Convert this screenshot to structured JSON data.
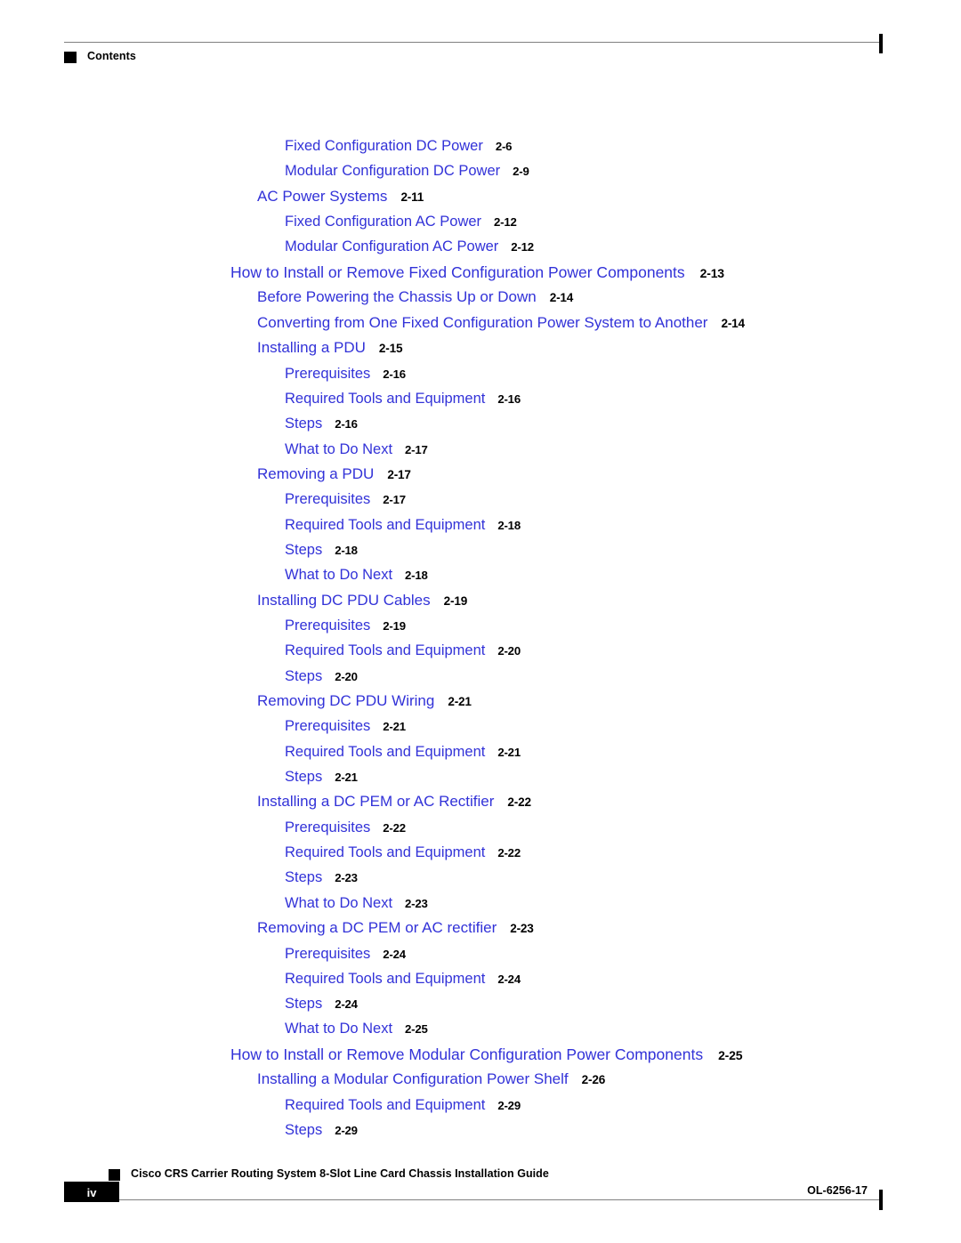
{
  "header": {
    "label": "Contents",
    "marker_icon": "black-square-icon"
  },
  "toc": {
    "entries": [
      {
        "level": 3,
        "title": "Fixed Configuration DC Power",
        "page": "2-6"
      },
      {
        "level": 3,
        "title": "Modular Configuration DC Power",
        "page": "2-9"
      },
      {
        "level": 2,
        "title": "AC Power Systems",
        "page": "2-11"
      },
      {
        "level": 3,
        "title": "Fixed Configuration AC Power",
        "page": "2-12"
      },
      {
        "level": 3,
        "title": "Modular Configuration AC Power",
        "page": "2-12"
      },
      {
        "level": 1,
        "title": "How to Install or Remove Fixed Configuration Power Components",
        "page": "2-13"
      },
      {
        "level": 2,
        "title": "Before Powering the Chassis Up or Down",
        "page": "2-14"
      },
      {
        "level": 2,
        "title": "Converting from One Fixed Configuration Power System to Another",
        "page": "2-14"
      },
      {
        "level": 2,
        "title": "Installing a PDU",
        "page": "2-15"
      },
      {
        "level": 3,
        "title": "Prerequisites",
        "page": "2-16"
      },
      {
        "level": 3,
        "title": "Required Tools and Equipment",
        "page": "2-16"
      },
      {
        "level": 3,
        "title": "Steps",
        "page": "2-16"
      },
      {
        "level": 3,
        "title": "What to Do Next",
        "page": "2-17"
      },
      {
        "level": 2,
        "title": "Removing a PDU",
        "page": "2-17"
      },
      {
        "level": 3,
        "title": "Prerequisites",
        "page": "2-17"
      },
      {
        "level": 3,
        "title": "Required Tools and Equipment",
        "page": "2-18"
      },
      {
        "level": 3,
        "title": "Steps",
        "page": "2-18"
      },
      {
        "level": 3,
        "title": "What to Do Next",
        "page": "2-18"
      },
      {
        "level": 2,
        "title": "Installing DC PDU Cables",
        "page": "2-19"
      },
      {
        "level": 3,
        "title": "Prerequisites",
        "page": "2-19"
      },
      {
        "level": 3,
        "title": "Required Tools and Equipment",
        "page": "2-20"
      },
      {
        "level": 3,
        "title": "Steps",
        "page": "2-20"
      },
      {
        "level": 2,
        "title": "Removing DC PDU Wiring",
        "page": "2-21"
      },
      {
        "level": 3,
        "title": "Prerequisites",
        "page": "2-21"
      },
      {
        "level": 3,
        "title": "Required Tools and Equipment",
        "page": "2-21"
      },
      {
        "level": 3,
        "title": "Steps",
        "page": "2-21"
      },
      {
        "level": 2,
        "title": "Installing a DC PEM or AC Rectifier",
        "page": "2-22"
      },
      {
        "level": 3,
        "title": "Prerequisites",
        "page": "2-22"
      },
      {
        "level": 3,
        "title": "Required Tools and Equipment",
        "page": "2-22"
      },
      {
        "level": 3,
        "title": "Steps",
        "page": "2-23"
      },
      {
        "level": 3,
        "title": "What to Do Next",
        "page": "2-23"
      },
      {
        "level": 2,
        "title": "Removing a DC PEM or AC rectifier",
        "page": "2-23"
      },
      {
        "level": 3,
        "title": "Prerequisites",
        "page": "2-24"
      },
      {
        "level": 3,
        "title": "Required Tools and Equipment",
        "page": "2-24"
      },
      {
        "level": 3,
        "title": "Steps",
        "page": "2-24"
      },
      {
        "level": 3,
        "title": "What to Do Next",
        "page": "2-25"
      },
      {
        "level": 1,
        "title": "How to Install or Remove Modular Configuration Power Components",
        "page": "2-25"
      },
      {
        "level": 2,
        "title": "Installing a Modular Configuration Power Shelf",
        "page": "2-26"
      },
      {
        "level": 3,
        "title": "Required Tools and Equipment",
        "page": "2-29"
      },
      {
        "level": 3,
        "title": "Steps",
        "page": "2-29"
      }
    ]
  },
  "footer": {
    "page_number": "iv",
    "document_title": "Cisco CRS Carrier Routing System 8-Slot Line Card Chassis Installation Guide",
    "document_id": "OL-6256-17",
    "marker_icon": "black-square-icon"
  },
  "colors": {
    "link_blue": "#3232d8",
    "text_black": "#000000",
    "rule_gray": "#808080"
  }
}
